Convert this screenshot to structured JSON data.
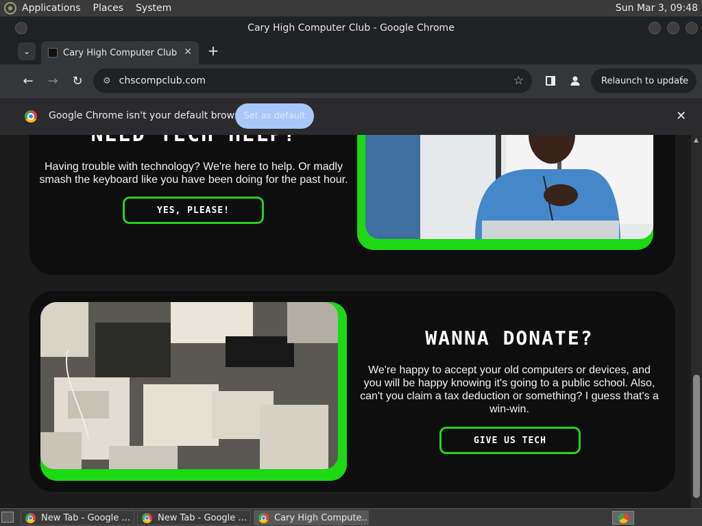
{
  "top_panel": {
    "menus": [
      "Applications",
      "Places",
      "System"
    ],
    "clock": "Sun Mar  3, 09:48"
  },
  "window": {
    "title": "Cary High Computer Club - Google Chrome"
  },
  "tabs": {
    "active_title": "Cary High Computer Club",
    "close_glyph": "✕",
    "new_tab_glyph": "+",
    "search_glyph": "⌄"
  },
  "toolbar": {
    "back_glyph": "←",
    "forward_glyph": "→",
    "reload_glyph": "↻",
    "url": "chscompclub.com",
    "star_glyph": "☆",
    "relaunch_label": "Relaunch to update",
    "menu_glyph": "⋮"
  },
  "infobar": {
    "message": "Google Chrome isn't your default browser",
    "set_default_label": "Set as default",
    "close_glyph": "✕"
  },
  "page": {
    "help": {
      "title": "NEED TECH HELP?",
      "text": "Having trouble with technology? We're here to help. Or madly smash the keyboard like you have been doing for the past hour.",
      "button": "YES, PLEASE!"
    },
    "donate": {
      "title": "WANNA DONATE?",
      "text": "We're happy to accept your old computers or devices, and you will be happy knowing it's going to a public school. Also, can't you claim a tax deduction or something? I guess that's a win-win.",
      "button": "GIVE US TECH"
    },
    "accent_color": "#1cd914"
  },
  "taskbar": {
    "tasks": [
      {
        "label": "New Tab - Google ..."
      },
      {
        "label": "New Tab - Google ..."
      },
      {
        "label": "Cary High Compute..."
      }
    ]
  },
  "icons": {
    "chrome": "chrome-icon",
    "profile": "profile-icon",
    "side_panel": "side-panel-icon",
    "site_info": "tune-icon"
  }
}
